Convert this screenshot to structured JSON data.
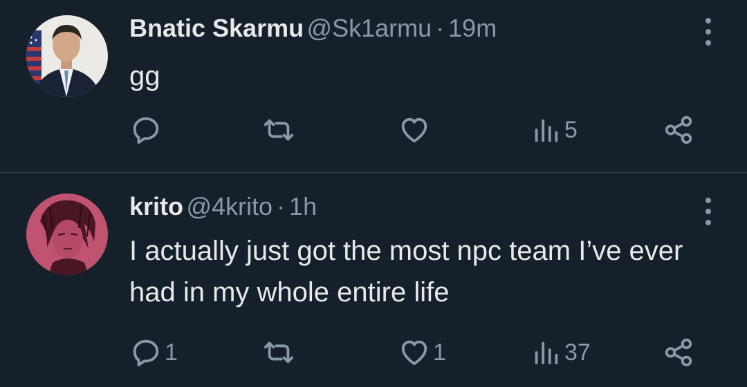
{
  "tweets": [
    {
      "name": "Bnatic Skarmu",
      "handle": "@Sk1armu",
      "separator": "·",
      "time": "19m",
      "text": "gg",
      "avatar_icon": "avatar-suit-man-flag",
      "replies": "",
      "retweets": "",
      "likes": "",
      "views": "5"
    },
    {
      "name": "krito",
      "handle": "@4krito",
      "separator": "·",
      "time": "1h",
      "text": "I actually just got the most npc team I’ve ever had in my whole entire life",
      "avatar_icon": "avatar-anime-drawing",
      "replies": "1",
      "retweets": "",
      "likes": "1",
      "views": "37"
    }
  ],
  "colors": {
    "background": "#15202b",
    "primary_text": "#e7e9ea",
    "secondary_text": "#8b98a5",
    "divider": "#38444d",
    "avatar2_bg": "#c05470"
  }
}
